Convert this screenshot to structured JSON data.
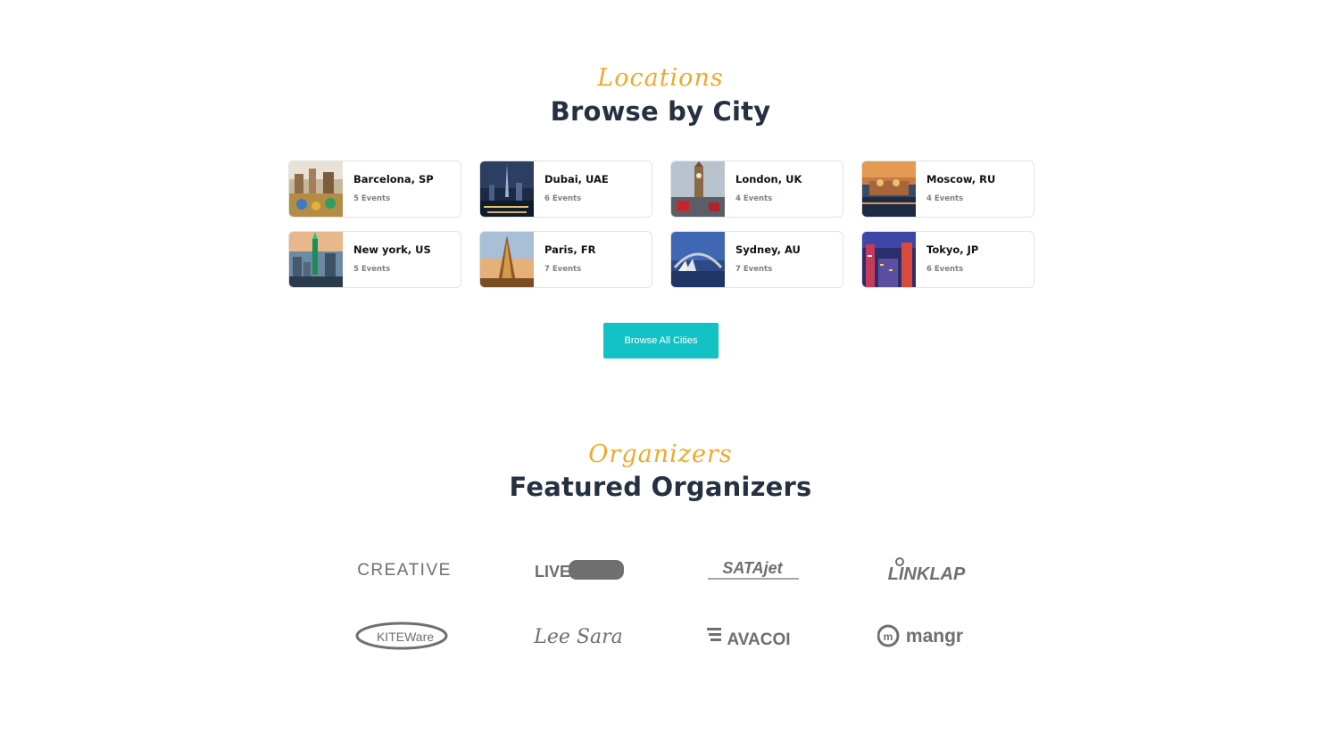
{
  "locations": {
    "eyebrow": "Locations",
    "heading": "Browse by City",
    "cities": [
      {
        "name": "Barcelona, SP",
        "events": "5 Events",
        "thumb": "barcelona-photo"
      },
      {
        "name": "Dubai, UAE",
        "events": "6 Events",
        "thumb": "dubai-photo"
      },
      {
        "name": "London, UK",
        "events": "4 Events",
        "thumb": "london-photo"
      },
      {
        "name": "Moscow, RU",
        "events": "4 Events",
        "thumb": "moscow-photo"
      },
      {
        "name": "New york, US",
        "events": "5 Events",
        "thumb": "new-york-photo"
      },
      {
        "name": "Paris, FR",
        "events": "7 Events",
        "thumb": "paris-photo"
      },
      {
        "name": "Sydney, AU",
        "events": "7 Events",
        "thumb": "sydney-photo"
      },
      {
        "name": "Tokyo, JP",
        "events": "6 Events",
        "thumb": "tokyo-photo"
      }
    ],
    "browse_button": "Browse All Cities"
  },
  "organizers": {
    "eyebrow": "Organizers",
    "heading": "Featured Organizers",
    "logos": [
      {
        "text": "CREATIVE"
      },
      {
        "text": "LIVECODE"
      },
      {
        "text": "SATAjet"
      },
      {
        "text": "LINKLAP"
      },
      {
        "text": "KITEWare"
      },
      {
        "text": "Lee Sara"
      },
      {
        "text": "AVACOI"
      },
      {
        "text": "mangr"
      }
    ]
  },
  "colors": {
    "accent_orange": "#f0a92a",
    "heading_dark": "#253040",
    "button_teal": "#12c2c4",
    "logo_gray": "#6f6f6f"
  }
}
